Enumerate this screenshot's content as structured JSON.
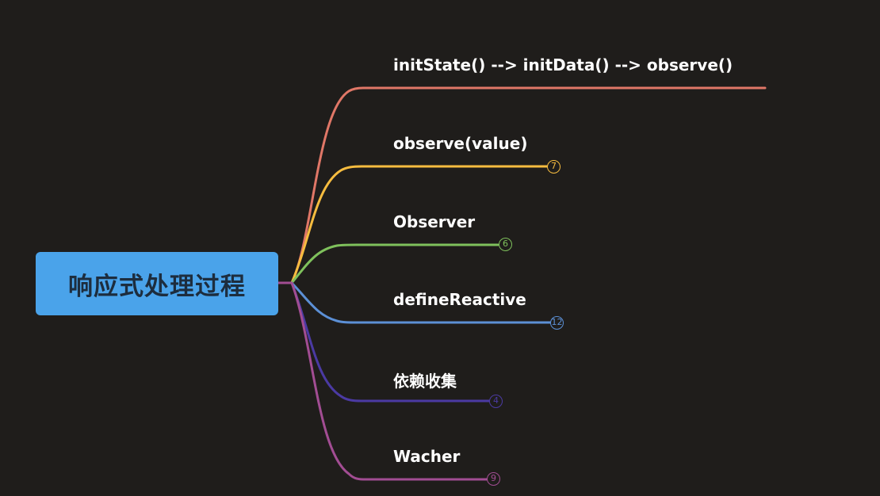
{
  "root": {
    "label": "响应式处理过程"
  },
  "branches": [
    {
      "label": "initState()  --> initData()  --> observe()",
      "badge": null,
      "color": "#e07767"
    },
    {
      "label": "observe(value)",
      "badge": "7",
      "color": "#f6bc3f"
    },
    {
      "label": "Observer",
      "badge": "6",
      "color": "#7fc15c"
    },
    {
      "label": "defineReactive",
      "badge": "12",
      "color": "#5c90d6"
    },
    {
      "label": "依赖收集",
      "badge": "4",
      "color": "#4b3aa3"
    },
    {
      "label": "Wacher",
      "badge": "9",
      "color": "#a24d93"
    }
  ]
}
